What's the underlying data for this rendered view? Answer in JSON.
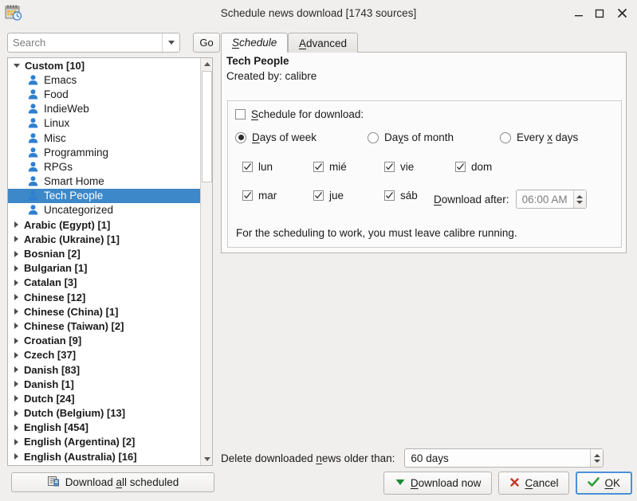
{
  "window": {
    "title": "Schedule news download [1743 sources]",
    "icon": "calendar-schedule-icon",
    "minimize_label": "–",
    "maximize_label": "☐",
    "close_label": "✕"
  },
  "search": {
    "placeholder": "Search",
    "value": "",
    "dropdown_icon": "chevron-down-icon",
    "go_label": "Go"
  },
  "tree": {
    "nodes": [
      {
        "label": "Custom [10]",
        "type": "group",
        "expanded": true
      },
      {
        "label": "Emacs",
        "type": "leaf",
        "selected": false
      },
      {
        "label": "Food",
        "type": "leaf",
        "selected": false
      },
      {
        "label": "IndieWeb",
        "type": "leaf",
        "selected": false
      },
      {
        "label": "Linux",
        "type": "leaf",
        "selected": false
      },
      {
        "label": "Misc",
        "type": "leaf",
        "selected": false
      },
      {
        "label": "Programming",
        "type": "leaf",
        "selected": false
      },
      {
        "label": "RPGs",
        "type": "leaf",
        "selected": false
      },
      {
        "label": "Smart Home",
        "type": "leaf",
        "selected": false
      },
      {
        "label": "Tech People",
        "type": "leaf",
        "selected": true
      },
      {
        "label": "Uncategorized",
        "type": "leaf",
        "selected": false
      },
      {
        "label": "Arabic (Egypt) [1]",
        "type": "group",
        "expanded": false
      },
      {
        "label": "Arabic (Ukraine) [1]",
        "type": "group",
        "expanded": false
      },
      {
        "label": "Bosnian [2]",
        "type": "group",
        "expanded": false
      },
      {
        "label": "Bulgarian [1]",
        "type": "group",
        "expanded": false
      },
      {
        "label": "Catalan [3]",
        "type": "group",
        "expanded": false
      },
      {
        "label": "Chinese [12]",
        "type": "group",
        "expanded": false
      },
      {
        "label": "Chinese (China) [1]",
        "type": "group",
        "expanded": false
      },
      {
        "label": "Chinese (Taiwan) [2]",
        "type": "group",
        "expanded": false
      },
      {
        "label": "Croatian [9]",
        "type": "group",
        "expanded": false
      },
      {
        "label": "Czech [37]",
        "type": "group",
        "expanded": false
      },
      {
        "label": "Danish [83]",
        "type": "group",
        "expanded": false
      },
      {
        "label": "Danish [1]",
        "type": "group",
        "expanded": false
      },
      {
        "label": "Dutch [24]",
        "type": "group",
        "expanded": false
      },
      {
        "label": "Dutch (Belgium) [13]",
        "type": "group",
        "expanded": false
      },
      {
        "label": "English [454]",
        "type": "group",
        "expanded": false
      },
      {
        "label": "English (Argentina) [2]",
        "type": "group",
        "expanded": false
      },
      {
        "label": "English (Australia) [16]",
        "type": "group",
        "expanded": false
      }
    ]
  },
  "download_all_button": {
    "label": "Download all scheduled",
    "icon": "download-news-icon"
  },
  "tabs": [
    {
      "label": "Schedule",
      "active": true
    },
    {
      "label": "Advanced",
      "active": false
    }
  ],
  "source": {
    "title": "Tech People",
    "created_by": "Created by: calibre"
  },
  "schedule": {
    "enable_label": "Schedule for download:",
    "enable_checked": false,
    "modes": [
      {
        "label": "Days of  week",
        "selected": true
      },
      {
        "label": "Days of month",
        "selected": false
      },
      {
        "label": "Every x days",
        "selected": false
      }
    ],
    "days": [
      {
        "label": "lun",
        "checked": true
      },
      {
        "label": "mié",
        "checked": true
      },
      {
        "label": "vie",
        "checked": true
      },
      {
        "label": "dom",
        "checked": true
      },
      {
        "label": "mar",
        "checked": true
      },
      {
        "label": "jue",
        "checked": true
      },
      {
        "label": "sáb",
        "checked": true
      }
    ],
    "download_after_label": "Download after:",
    "download_after_value": "06:00 AM",
    "note": "For the scheduling to work, you must leave calibre running."
  },
  "footer": {
    "delete_label": "Delete downloaded news older than:",
    "delete_value": "60 days",
    "download_now_label": "Download now",
    "cancel_label": "Cancel",
    "ok_label": "OK"
  },
  "colors": {
    "selection": "#3d88c8",
    "window_bg": "#f0efee",
    "panel_bg": "#fbfbfb",
    "accent_focus": "#4a90d9",
    "ok_check": "#2d9e3f",
    "cancel_x": "#c0392b",
    "download_triangle": "#1f8a3b",
    "person_icon": "#2f7fd0"
  }
}
